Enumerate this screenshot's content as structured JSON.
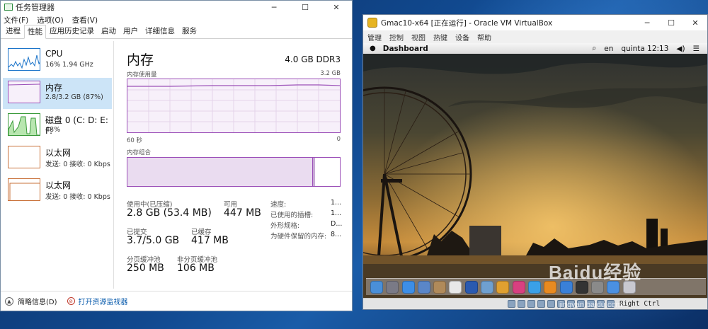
{
  "task_manager": {
    "title": "任务管理器",
    "menu": [
      "文件(F)",
      "选项(O)",
      "查看(V)"
    ],
    "tabs": [
      "进程",
      "性能",
      "应用历史记录",
      "启动",
      "用户",
      "详细信息",
      "服务"
    ],
    "active_tab": "性能",
    "sidebar": [
      {
        "name": "CPU",
        "sub": "16% 1.94 GHz",
        "color": "#1a73c9"
      },
      {
        "name": "内存",
        "sub": "2.8/3.2 GB (87%)",
        "color": "#9b4fb8"
      },
      {
        "name": "磁盘 0 (C: D: E: F:",
        "sub": "48%",
        "color": "#3a9a3a"
      },
      {
        "name": "以太网",
        "sub": "发送: 0 接收: 0 Kbps",
        "color": "#c9713a"
      },
      {
        "name": "以太网",
        "sub": "发送: 0 接收: 0 Kbps",
        "color": "#c9713a"
      }
    ],
    "memory": {
      "title": "内存",
      "spec": "4.0 GB DDR3",
      "usage_label": "内存使用量",
      "usage_max": "3.2 GB",
      "time_left": "60 秒",
      "time_right": "0",
      "composition_label": "内存组合",
      "stats": [
        {
          "label": "使用中(已压缩)",
          "value": "2.8 GB (53.4 MB)"
        },
        {
          "label": "可用",
          "value": "447 MB"
        },
        {
          "label": "已提交",
          "value": "3.7/5.0 GB"
        },
        {
          "label": "已缓存",
          "value": "417 MB"
        },
        {
          "label": "分页缓冲池",
          "value": "250 MB"
        },
        {
          "label": "非分页缓冲池",
          "value": "106 MB"
        }
      ],
      "info": [
        {
          "label": "速度:",
          "value": "1..."
        },
        {
          "label": "已使用的插槽:",
          "value": "1..."
        },
        {
          "label": "外形规格:",
          "value": "D..."
        },
        {
          "label": "为硬件保留的内存:",
          "value": "8..."
        }
      ]
    },
    "footer": {
      "fewer_details": "简略信息(D)",
      "resource_monitor": "打开资源监视器"
    }
  },
  "virtualbox": {
    "title": "Gmac10-x64 [正在运行] - Oracle VM VirtualBox",
    "menu": [
      "管理",
      "控制",
      "视图",
      "热键",
      "设备",
      "帮助"
    ],
    "guest_menubar": {
      "app": "Dashboard",
      "lang": "en",
      "clock": "quinta 12:13"
    },
    "dock_icons": [
      {
        "name": "finder-icon",
        "color": "#4a8fd8"
      },
      {
        "name": "launchpad-icon",
        "color": "#7a7a86"
      },
      {
        "name": "safari-icon",
        "color": "#3d8ee6"
      },
      {
        "name": "mail-icon",
        "color": "#5a86c8"
      },
      {
        "name": "contacts-icon",
        "color": "#b08a5a"
      },
      {
        "name": "calendar-icon",
        "color": "#e8e8e8"
      },
      {
        "name": "quicktime-icon",
        "color": "#2a5ab0"
      },
      {
        "name": "preview-icon",
        "color": "#6fa0d0"
      },
      {
        "name": "photos-icon",
        "color": "#e0a030"
      },
      {
        "name": "itunes-icon",
        "color": "#d84080"
      },
      {
        "name": "messages-icon",
        "color": "#3aa0e8"
      },
      {
        "name": "ibooks-icon",
        "color": "#e88a20"
      },
      {
        "name": "appstore-icon",
        "color": "#3a80d8"
      },
      {
        "name": "terminal-icon",
        "color": "#333333"
      },
      {
        "name": "system-prefs-icon",
        "color": "#8a8a8a"
      },
      {
        "name": "network-icon",
        "color": "#4a90e2"
      },
      {
        "name": "trash-icon",
        "color": "#c8c8d0"
      }
    ],
    "host_key": "Right Ctrl"
  },
  "watermark": {
    "brand": "Baidu经验",
    "url": "jingyan.baidu.com"
  }
}
